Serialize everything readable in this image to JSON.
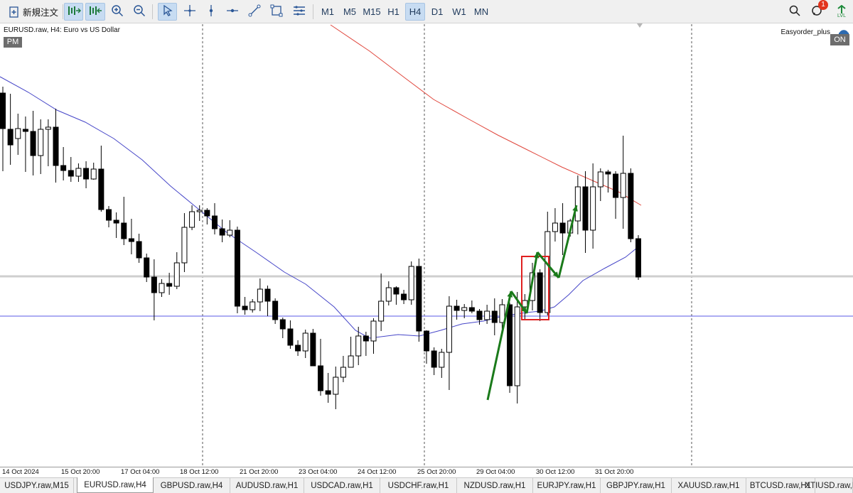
{
  "toolbar": {
    "new_order_label": "新規注文",
    "timeframes": [
      "M1",
      "M5",
      "M15",
      "H1",
      "H4",
      "D1",
      "W1",
      "MN"
    ],
    "active_timeframe": "H4",
    "notification_count": "1",
    "lvl_label": "LVL"
  },
  "chart": {
    "symbol_label": "EURUSD.raw, H4:  Euro vs US Dollar",
    "pm_label": "PM",
    "ea_label": "Easyorder_plus",
    "ea_status": "ON",
    "time_labels": [
      "14 Oct 2024",
      "15 Oct 20:00",
      "17 Oct 04:00",
      "18 Oct 12:00",
      "21 Oct 20:00",
      "23 Oct 04:00",
      "24 Oct 12:00",
      "25 Oct 20:00",
      "29 Oct 04:00",
      "30 Oct 12:00",
      "31 Oct 20:00"
    ],
    "colors": {
      "ma_fast": "#4646c8",
      "ma_slow": "#e0463c",
      "hline": "#5a5ae6",
      "arrow": "#1a7a1a",
      "highlight": "#e02020"
    }
  },
  "chart_data": {
    "type": "candlestick",
    "symbol": "EURUSD.raw",
    "timeframe": "H4",
    "description": "Euro vs US Dollar",
    "x": [
      "14 Oct 2024",
      "15 Oct 20:00",
      "17 Oct 04:00",
      "18 Oct 12:00",
      "21 Oct 20:00",
      "23 Oct 04:00",
      "24 Oct 12:00",
      "25 Oct 20:00",
      "29 Oct 04:00",
      "30 Oct 12:00",
      "31 Oct 20:00"
    ],
    "candles": [
      [
        131,
        181,
        122,
        241
      ],
      [
        182,
        204,
        132,
        232
      ],
      [
        195,
        181,
        160,
        218
      ],
      [
        182,
        185,
        164,
        242
      ],
      [
        185,
        219,
        156,
        247
      ],
      [
        219,
        182,
        168,
        245
      ],
      [
        182,
        179,
        168,
        234
      ],
      [
        179,
        233,
        153,
        257
      ],
      [
        233,
        240,
        207,
        254
      ],
      [
        240,
        248,
        221,
        256
      ],
      [
        248,
        237,
        230,
        256
      ],
      [
        237,
        252,
        227,
        265
      ],
      [
        252,
        238,
        229,
        253
      ],
      [
        238,
        295,
        205,
        298
      ],
      [
        295,
        310,
        290,
        320
      ],
      [
        310,
        314,
        299,
        335
      ],
      [
        314,
        336,
        277,
        345
      ],
      [
        336,
        340,
        308,
        358
      ],
      [
        340,
        363,
        329,
        370
      ],
      [
        363,
        390,
        357,
        397
      ],
      [
        390,
        412,
        365,
        451
      ],
      [
        412,
        399,
        393,
        418
      ],
      [
        399,
        403,
        384,
        415
      ],
      [
        403,
        370,
        355,
        407
      ],
      [
        370,
        320,
        300,
        383
      ],
      [
        320,
        298,
        289,
        324
      ],
      [
        298,
        296,
        289,
        311
      ],
      [
        296,
        304,
        293,
        316
      ],
      [
        304,
        322,
        286,
        330
      ],
      [
        322,
        331,
        309,
        341
      ],
      [
        331,
        324,
        310,
        334
      ],
      [
        324,
        431,
        319,
        441
      ],
      [
        431,
        436,
        418,
        443
      ],
      [
        436,
        425,
        421,
        440
      ],
      [
        425,
        407,
        392,
        438
      ],
      [
        407,
        424,
        402,
        445
      ],
      [
        424,
        450,
        420,
        456
      ],
      [
        450,
        463,
        447,
        476
      ],
      [
        463,
        486,
        451,
        491
      ],
      [
        486,
        494,
        479,
        501
      ],
      [
        494,
        469,
        464,
        504
      ],
      [
        469,
        515,
        463,
        515
      ],
      [
        515,
        550,
        477,
        557
      ],
      [
        550,
        555,
        525,
        567
      ],
      [
        555,
        531,
        516,
        576
      ],
      [
        531,
        517,
        501,
        538
      ],
      [
        517,
        501,
        474,
        511
      ],
      [
        501,
        473,
        460,
        514
      ],
      [
        473,
        480,
        467,
        501
      ],
      [
        480,
        452,
        448,
        498
      ],
      [
        452,
        424,
        385,
        466
      ],
      [
        424,
        405,
        396,
        430
      ],
      [
        405,
        414,
        403,
        429
      ],
      [
        414,
        422,
        408,
        428
      ],
      [
        422,
        375,
        368,
        429
      ],
      [
        375,
        466,
        364,
        481
      ],
      [
        466,
        494,
        465,
        512
      ],
      [
        494,
        517,
        489,
        528
      ],
      [
        517,
        496,
        491,
        532
      ],
      [
        496,
        431,
        417,
        549
      ],
      [
        431,
        437,
        422,
        450
      ],
      [
        437,
        433,
        428,
        448
      ],
      [
        433,
        438,
        423,
        441
      ],
      [
        438,
        450,
        435,
        457
      ],
      [
        450,
        438,
        429,
        456
      ],
      [
        438,
        454,
        420,
        472
      ],
      [
        454,
        429,
        421,
        463
      ],
      [
        429,
        543,
        426,
        553
      ],
      [
        543,
        432,
        411,
        568
      ],
      [
        432,
        423,
        414,
        449
      ],
      [
        423,
        384,
        370,
        437
      ],
      [
        384,
        440,
        379,
        452
      ],
      [
        440,
        326,
        298,
        444
      ],
      [
        326,
        314,
        293,
        340
      ],
      [
        314,
        328,
        286,
        359
      ],
      [
        328,
        311,
        308,
        333
      ],
      [
        311,
        263,
        247,
        330
      ],
      [
        263,
        324,
        241,
        356
      ],
      [
        324,
        263,
        230,
        350
      ],
      [
        263,
        242,
        237,
        283
      ],
      [
        242,
        245,
        239,
        271
      ],
      [
        245,
        278,
        241,
        308
      ],
      [
        278,
        244,
        191,
        322
      ],
      [
        244,
        336,
        237,
        341
      ],
      [
        336,
        390,
        331,
        394
      ]
    ],
    "candle_note": "Each candle: [open, close, high, low] read on the chart's vertical scale (no price axis visible)",
    "ma_fast_label": "Moving average (blue)",
    "ma_slow_label": "Moving average (red)"
  }
}
